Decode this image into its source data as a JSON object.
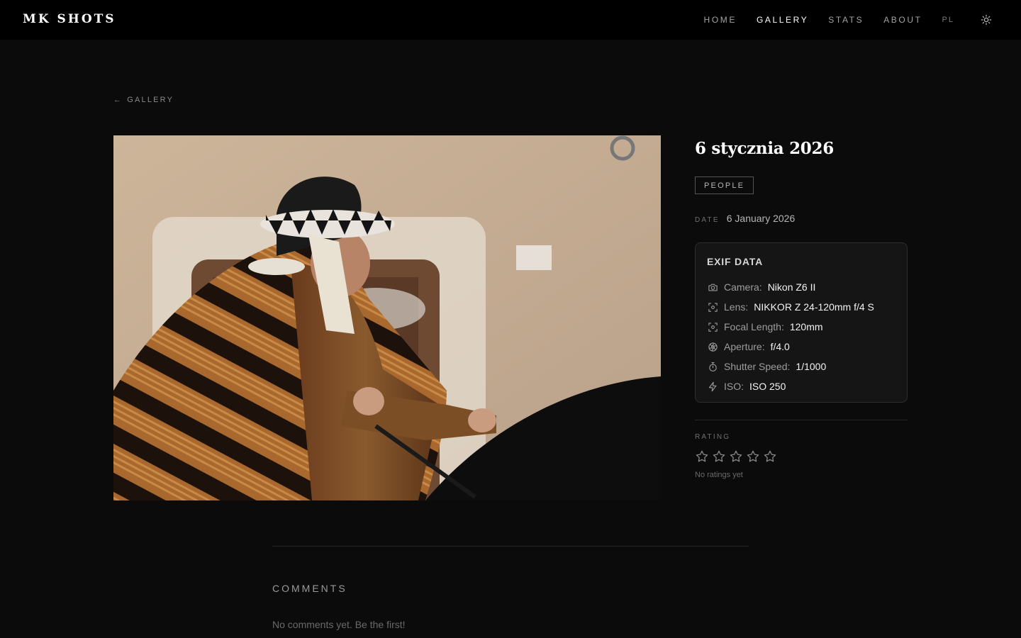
{
  "brand": {
    "logo": "MK SHOTS"
  },
  "nav": {
    "items": [
      {
        "label": "HOME",
        "active": false
      },
      {
        "label": "GALLERY",
        "active": true
      },
      {
        "label": "STATS",
        "active": false
      },
      {
        "label": "ABOUT",
        "active": false
      }
    ],
    "language": "PL",
    "theme_icon": "sun-icon"
  },
  "back_link": {
    "arrow": "←",
    "label": "GALLERY"
  },
  "photo": {
    "title": "6 stycznia 2026",
    "category_tag": "PEOPLE"
  },
  "details": {
    "date_label": "DATE",
    "date_value": "6 January 2026"
  },
  "exif": {
    "title": "EXIF DATA",
    "rows": [
      {
        "icon": "camera-icon",
        "label": "Camera:",
        "value": "Nikon Z6 II"
      },
      {
        "icon": "lens-icon",
        "label": "Lens:",
        "value": "NIKKOR Z 24-120mm f/4 S"
      },
      {
        "icon": "focal-length-icon",
        "label": "Focal Length:",
        "value": "120mm"
      },
      {
        "icon": "aperture-icon",
        "label": "Aperture:",
        "value": "f/4.0"
      },
      {
        "icon": "timer-icon",
        "label": "Shutter Speed:",
        "value": "1/1000"
      },
      {
        "icon": "lightning-icon",
        "label": "ISO:",
        "value": "ISO 250"
      }
    ]
  },
  "rating": {
    "label": "RATING",
    "stars_filled": 0,
    "stars_total": 5,
    "empty_text": "No ratings yet"
  },
  "comments": {
    "title": "COMMENTS",
    "empty_text": "No comments yet. Be the first!"
  }
}
